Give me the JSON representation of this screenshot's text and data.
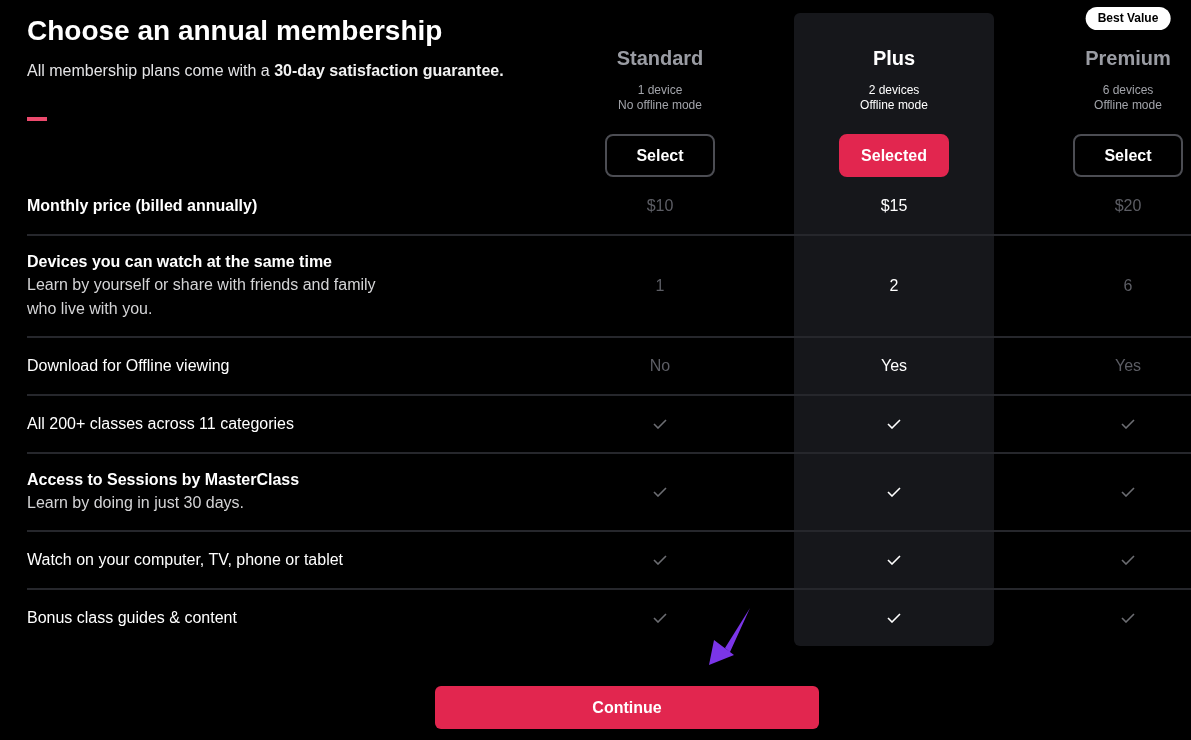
{
  "header": {
    "title": "Choose an annual membership",
    "subtitle": "All membership plans come with a **30-day satisfaction guarantee.**"
  },
  "plans": [
    {
      "name": "Standard",
      "devices": "1 device",
      "offline": "No offline mode",
      "button": "Select",
      "selected": false
    },
    {
      "name": "Plus",
      "devices": "2 devices",
      "offline": "Offline mode",
      "button": "Selected",
      "selected": true
    },
    {
      "name": "Premium",
      "badge": "Best Value",
      "devices": "6 devices",
      "offline": "Offline mode",
      "button": "Select",
      "selected": false
    }
  ],
  "features": [
    {
      "kind": "text",
      "label": "Monthly price (billed annually)",
      "bold": true,
      "values": [
        "$10",
        "$15",
        "$20"
      ]
    },
    {
      "kind": "text",
      "label": "Devices you can watch at the same time",
      "bold": true,
      "description": "Learn by yourself or share with friends and family who live with you.",
      "values": [
        "1",
        "2",
        "6"
      ]
    },
    {
      "kind": "text",
      "label": "Download for Offline viewing",
      "bold": false,
      "values": [
        "No",
        "Yes",
        "Yes"
      ]
    },
    {
      "kind": "check",
      "label": "All 200+ classes across 11 categories",
      "bold": false,
      "included": [
        true,
        true,
        true
      ]
    },
    {
      "kind": "check",
      "label": "Access to Sessions by MasterClass",
      "bold": true,
      "description": "Learn by doing in just 30 days.",
      "included": [
        true,
        true,
        true
      ]
    },
    {
      "kind": "check",
      "label": "Watch on your computer, TV, phone or tablet",
      "bold": false,
      "included": [
        true,
        true,
        true
      ]
    },
    {
      "kind": "check",
      "label": "Bonus class guides & content",
      "bold": false,
      "included": [
        true,
        true,
        true
      ]
    }
  ],
  "continue_button": "Continue"
}
